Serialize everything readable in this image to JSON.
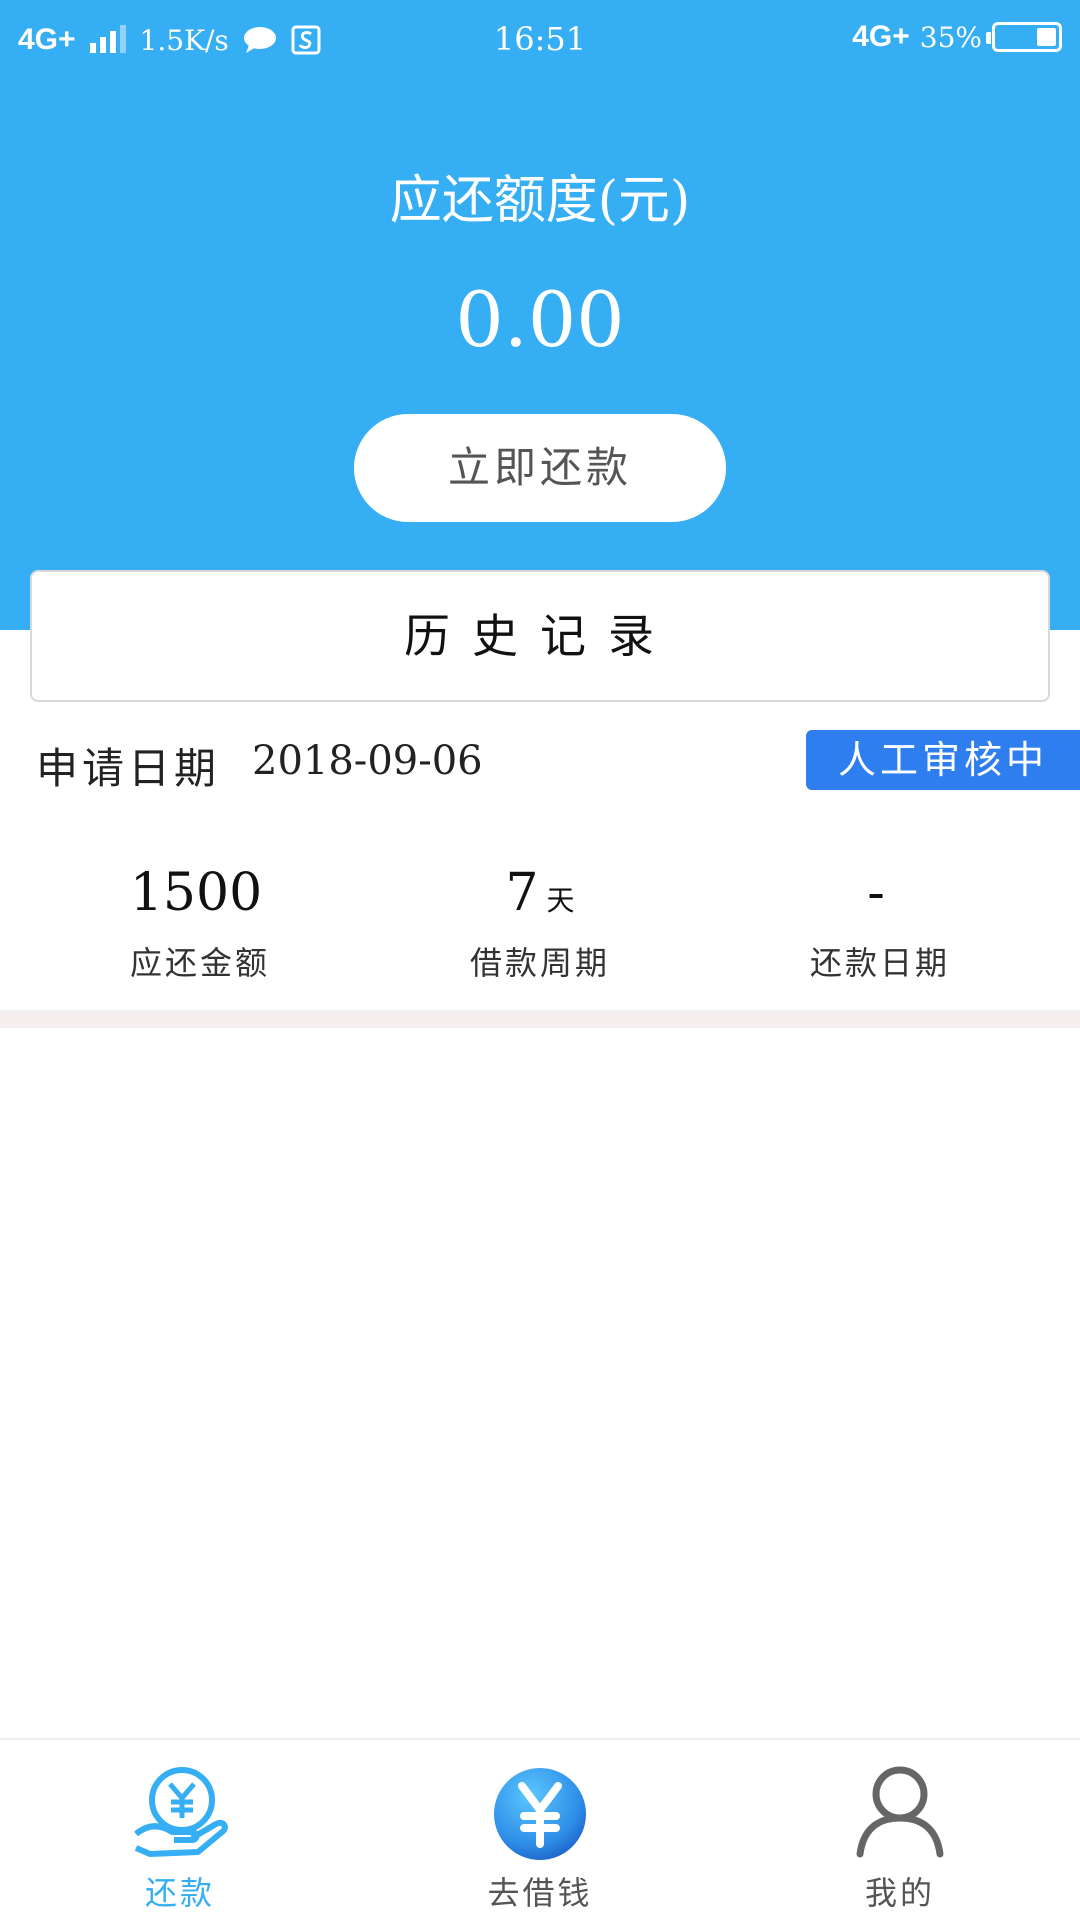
{
  "status_bar": {
    "network": "4G+",
    "speed": "1.5K/s",
    "time": "16:51",
    "network_right": "4G+",
    "battery": "35%"
  },
  "header": {
    "amount_title": "应还额度(元)",
    "amount_value": "0.00",
    "repay_button": "立即还款"
  },
  "history": {
    "title": "历史记录"
  },
  "application": {
    "date_label": "申请日期",
    "date": "2018-09-06",
    "status": "人工审核中"
  },
  "stats": [
    {
      "value": "1500",
      "unit": "",
      "label": "应还金额"
    },
    {
      "value": "7",
      "unit": "天",
      "label": "借款周期"
    },
    {
      "value": "-",
      "unit": "",
      "label": "还款日期"
    }
  ],
  "bottom_nav": [
    {
      "label": "还款",
      "icon": "repay-hand-yen-icon",
      "active": true
    },
    {
      "label": "去借钱",
      "icon": "yen-coin-icon",
      "active": false
    },
    {
      "label": "我的",
      "icon": "person-icon",
      "active": false
    }
  ],
  "colors": {
    "header_bg": "#36aef4",
    "badge_bg": "#2f7ef0",
    "active_tab": "#36aef4"
  }
}
